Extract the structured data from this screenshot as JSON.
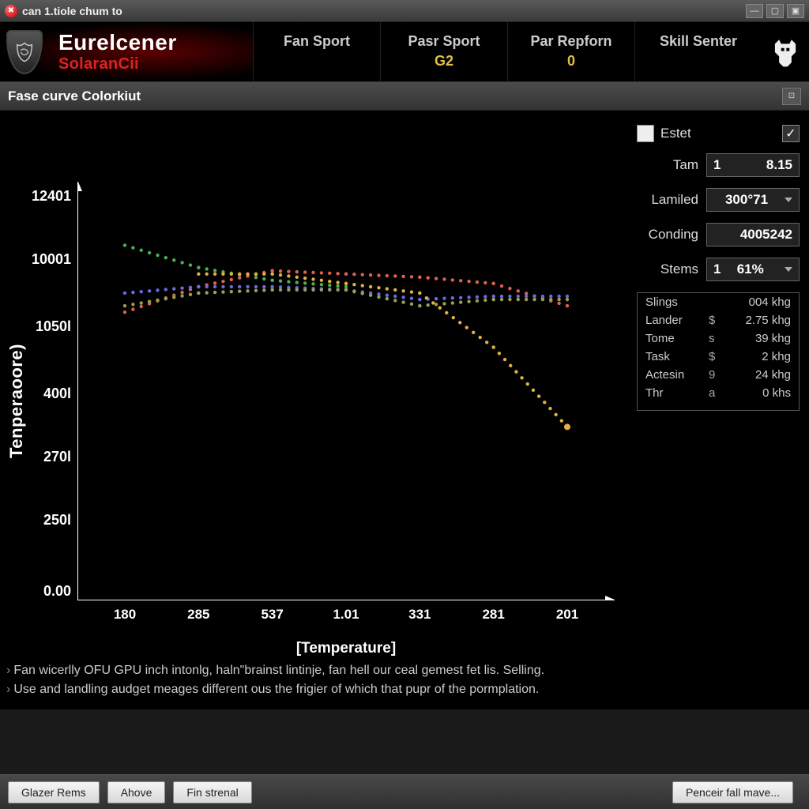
{
  "window": {
    "title": "can 1.tiole chum to"
  },
  "brand": {
    "line1": "Eurelcener",
    "line2": "SolaranCii"
  },
  "tabs": [
    {
      "label": "Fan Sport",
      "value": ""
    },
    {
      "label": "Pasr Sport",
      "value": "G2"
    },
    {
      "label": "Par Repforn",
      "value": "0"
    },
    {
      "label": "Skill Senter",
      "value": ""
    }
  ],
  "subheader": {
    "title": "Fase curve Colorkiut"
  },
  "chart_data": {
    "type": "line",
    "xlabel": "[Temperature]",
    "ylabel": "Tenperaoore)",
    "x_ticks": [
      "180",
      "285",
      "537",
      "1.01",
      "331",
      "281",
      "201"
    ],
    "y_ticks": [
      "12401",
      "10001",
      "1050l",
      "400l",
      "270l",
      "250l",
      "0.00"
    ],
    "x": [
      0,
      1,
      2,
      3,
      4,
      5,
      6
    ],
    "series": [
      {
        "name": "green",
        "color": "#4caf50",
        "values": [
          1090,
          1020,
          980,
          960,
          null,
          null,
          null
        ]
      },
      {
        "name": "red",
        "color": "#e06050",
        "values": [
          880,
          960,
          1010,
          1000,
          990,
          970,
          900
        ]
      },
      {
        "name": "blue",
        "color": "#6a6ae0",
        "values": [
          940,
          960,
          960,
          950,
          920,
          930,
          930
        ]
      },
      {
        "name": "orange",
        "color": "#e0b040",
        "values": [
          null,
          1000,
          1000,
          970,
          940,
          770,
          520
        ]
      },
      {
        "name": "olive",
        "color": "#9aa050",
        "values": [
          900,
          940,
          950,
          950,
          900,
          920,
          920
        ]
      }
    ],
    "ylim": [
      0,
      12401
    ]
  },
  "panel": {
    "estet_label": "Estet",
    "rows": [
      {
        "label": "Tam",
        "v1": "1",
        "v2": "8.15",
        "dropdown": false
      },
      {
        "label": "Lamiled",
        "v1": "",
        "v2": "300°71",
        "dropdown": true
      },
      {
        "label": "Conding",
        "v1": "",
        "v2": "4005242",
        "dropdown": false
      },
      {
        "label": "Stems",
        "v1": "1",
        "v2": "61%",
        "dropdown": true
      }
    ],
    "stats": [
      {
        "name": "Slings",
        "cur": "",
        "val": "004 khg"
      },
      {
        "name": "Lander",
        "cur": "$",
        "val": "2.75 khg"
      },
      {
        "name": "Tome",
        "cur": "s",
        "val": "39 khg"
      },
      {
        "name": "Task",
        "cur": "$",
        "val": "2 khg"
      },
      {
        "name": "Actesin",
        "cur": "9",
        "val": "24 khg"
      },
      {
        "name": "Thr",
        "cur": "a",
        "val": "0 khs"
      }
    ]
  },
  "notes": [
    "Fan wicerlly OFU GPU inch intonlg, haln\"brainst lintinje, fan hell our ceal gemest fet lis. Selling.",
    "Use and landling audget meages different ous the frigier of which that pupr of the pormplation."
  ],
  "footer": {
    "b1": "Glazer Rems",
    "b2": "Ahove",
    "b3": "Fin strenal",
    "b4": "Penceir fall mave..."
  }
}
